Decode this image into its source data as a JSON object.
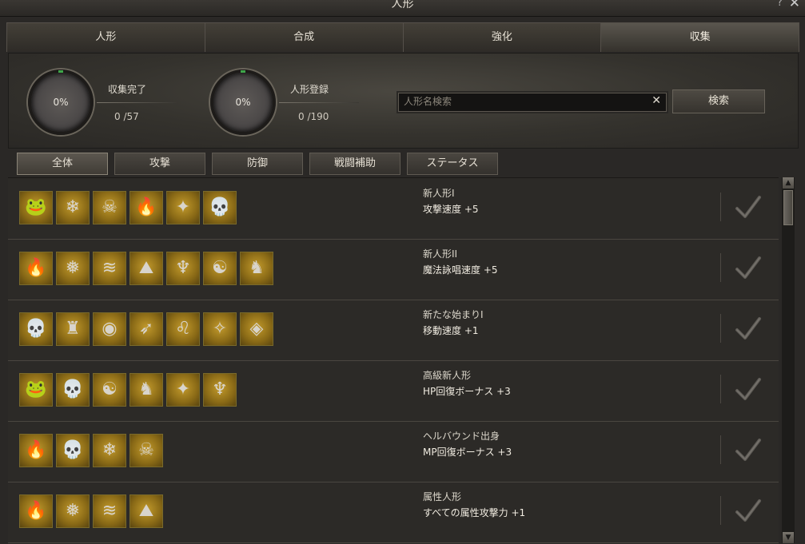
{
  "window": {
    "title": "人形"
  },
  "tabs": [
    {
      "label": "人形"
    },
    {
      "label": "合成"
    },
    {
      "label": "強化"
    },
    {
      "label": "収集",
      "active": true
    }
  ],
  "stats": {
    "collection": {
      "percent": "0%",
      "label": "収集完了",
      "count": "0 /57"
    },
    "registration": {
      "percent": "0%",
      "label": "人形登録",
      "count": "0 /190"
    }
  },
  "search": {
    "placeholder": "人形名検索",
    "value": "",
    "button": "検索"
  },
  "filters": [
    {
      "label": "全体",
      "active": true
    },
    {
      "label": "攻撃"
    },
    {
      "label": "防御"
    },
    {
      "label": "戦闘補助"
    },
    {
      "label": "ステータス"
    }
  ],
  "collections": [
    {
      "name": "新人形I",
      "effect": "攻撃速度 +5",
      "icons": [
        "frog-doll-icon",
        "ice-doll-icon",
        "pirate-doll-icon",
        "fire-beast-doll-icon",
        "crystal-doll-icon",
        "skeleton-doll-icon"
      ]
    },
    {
      "name": "新人形II",
      "effect": "魔法詠唱速度 +5",
      "icons": [
        "flame-doll-icon",
        "snow-doll-icon",
        "water-doll-icon",
        "stone-golem-doll-icon",
        "demon-doll-icon",
        "elder-doll-icon",
        "dragon-doll-icon"
      ]
    },
    {
      "name": "新たな始まりI",
      "effect": "移動速度 +1",
      "icons": [
        "skeleton-doll-icon",
        "knight-doll-icon",
        "orb-doll-icon",
        "ranger-doll-icon",
        "lion-doll-icon",
        "priestess-doll-icon",
        "shadow-doll-icon"
      ]
    },
    {
      "name": "高級新人形",
      "effect": "HP回復ボーナス +3",
      "icons": [
        "frog-doll-icon",
        "skeleton-doll-icon",
        "elder-doll-icon",
        "dragon-doll-icon",
        "crystal-doll-icon",
        "demon-doll-icon"
      ]
    },
    {
      "name": "ヘルバウンド出身",
      "effect": "MP回復ボーナス +3",
      "icons": [
        "fire-beast-doll-icon",
        "skeleton-doll-icon",
        "ice-doll-icon",
        "pirate-doll-icon"
      ]
    },
    {
      "name": "属性人形",
      "effect": "すべての属性攻撃力 +1",
      "icons": [
        "flame-doll-icon",
        "snow-doll-icon",
        "water-doll-icon",
        "stone-golem-doll-icon"
      ]
    }
  ]
}
